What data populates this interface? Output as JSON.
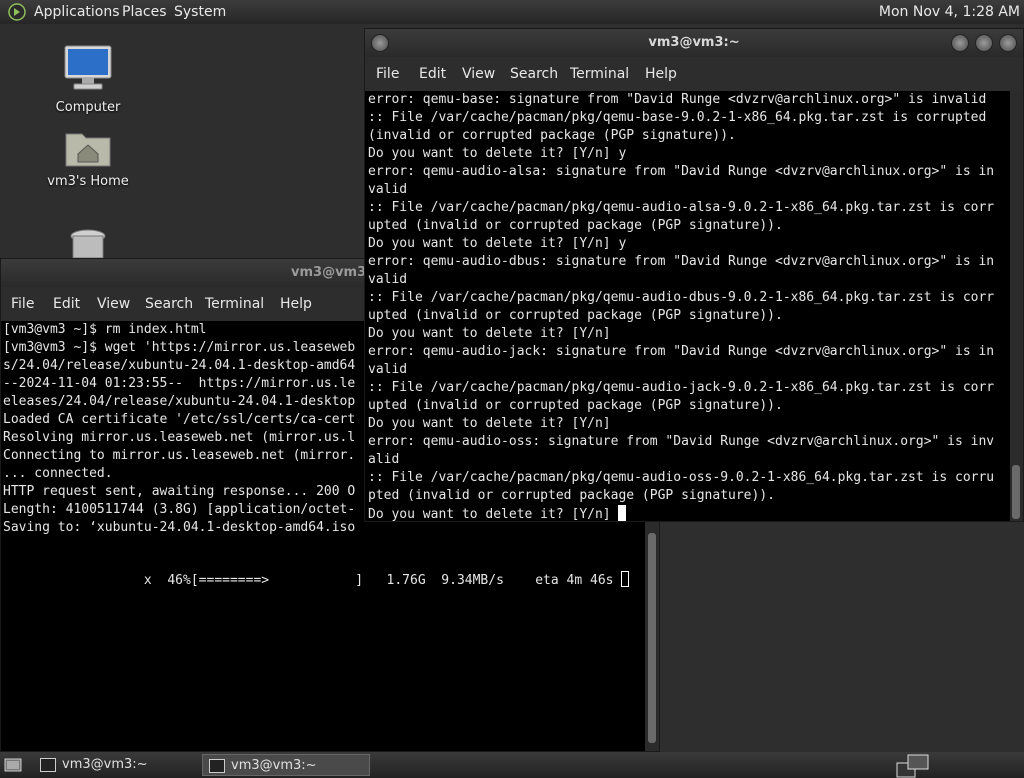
{
  "top_panel": {
    "menus": [
      "Applications",
      "Places",
      "System"
    ],
    "clock": "Mon Nov 4, 1:28 AM"
  },
  "desktop_icons": [
    {
      "label": "Computer",
      "icon": "computer-icon"
    },
    {
      "label": "vm3's Home",
      "icon": "home-folder-icon"
    },
    {
      "label": "",
      "icon": "trash-icon"
    }
  ],
  "window_front": {
    "title": "vm3@vm3:~",
    "menu": [
      "File",
      "Edit",
      "View",
      "Search",
      "Terminal",
      "Help"
    ],
    "lines": [
      "error: qemu-base: signature from \"David Runge <dvzrv@archlinux.org>\" is invalid",
      ":: File /var/cache/pacman/pkg/qemu-base-9.0.2-1-x86_64.pkg.tar.zst is corrupted",
      "(invalid or corrupted package (PGP signature)).",
      "Do you want to delete it? [Y/n] y",
      "error: qemu-audio-alsa: signature from \"David Runge <dvzrv@archlinux.org>\" is in",
      "valid",
      ":: File /var/cache/pacman/pkg/qemu-audio-alsa-9.0.2-1-x86_64.pkg.tar.zst is corr",
      "upted (invalid or corrupted package (PGP signature)).",
      "Do you want to delete it? [Y/n] y",
      "error: qemu-audio-dbus: signature from \"David Runge <dvzrv@archlinux.org>\" is in",
      "valid",
      ":: File /var/cache/pacman/pkg/qemu-audio-dbus-9.0.2-1-x86_64.pkg.tar.zst is corr",
      "upted (invalid or corrupted package (PGP signature)).",
      "Do you want to delete it? [Y/n]",
      "error: qemu-audio-jack: signature from \"David Runge <dvzrv@archlinux.org>\" is in",
      "valid",
      ":: File /var/cache/pacman/pkg/qemu-audio-jack-9.0.2-1-x86_64.pkg.tar.zst is corr",
      "upted (invalid or corrupted package (PGP signature)).",
      "Do you want to delete it? [Y/n]",
      "error: qemu-audio-oss: signature from \"David Runge <dvzrv@archlinux.org>\" is inv",
      "alid",
      ":: File /var/cache/pacman/pkg/qemu-audio-oss-9.0.2-1-x86_64.pkg.tar.zst is corru",
      "pted (invalid or corrupted package (PGP signature)).",
      "Do you want to delete it? [Y/n] "
    ]
  },
  "window_back": {
    "title": "vm3@vm3:~",
    "menu": [
      "File",
      "Edit",
      "View",
      "Search",
      "Terminal",
      "Help"
    ],
    "lines": [
      "[vm3@vm3 ~]$ rm index.html",
      "[vm3@vm3 ~]$ wget 'https://mirror.us.leaseweb",
      "s/24.04/release/xubuntu-24.04.1-desktop-amd64",
      "--2024-11-04 01:23:55--  https://mirror.us.le",
      "eleases/24.04/release/xubuntu-24.04.1-desktop",
      "Loaded CA certificate '/etc/ssl/certs/ca-cert",
      "Resolving mirror.us.leaseweb.net (mirror.us.l",
      "Connecting to mirror.us.leaseweb.net (mirror.",
      "... connected.",
      "HTTP request sent, awaiting response... 200 O",
      "Length: 4100511744 (3.8G) [application/octet-",
      "Saving to: ‘xubuntu-24.04.1-desktop-amd64.iso",
      "",
      "                  x  46%[========>           ]   1.76G  9.34MB/s    eta 4m 46s "
    ]
  },
  "taskbar": {
    "tasks": [
      "vm3@vm3:~",
      "vm3@vm3:~"
    ]
  }
}
